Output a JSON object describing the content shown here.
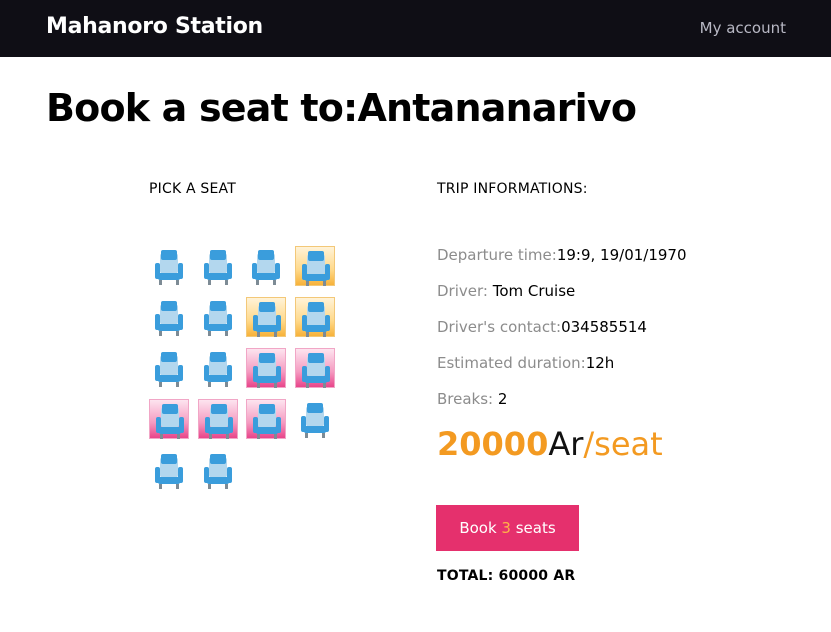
{
  "navbar": {
    "brand": "Mahanoro Station",
    "account_link": "My account"
  },
  "page": {
    "title": "Book a seat to:Antananarivo"
  },
  "pick": {
    "heading": "PICK A SEAT",
    "seats": [
      {
        "status": "available"
      },
      {
        "status": "available"
      },
      {
        "status": "available"
      },
      {
        "status": "selected"
      },
      {
        "status": "available"
      },
      {
        "status": "available"
      },
      {
        "status": "selected"
      },
      {
        "status": "selected"
      },
      {
        "status": "available"
      },
      {
        "status": "available"
      },
      {
        "status": "booked"
      },
      {
        "status": "booked"
      },
      {
        "status": "booked"
      },
      {
        "status": "booked"
      },
      {
        "status": "booked"
      },
      {
        "status": "available"
      },
      {
        "status": "available"
      },
      {
        "status": "available"
      }
    ]
  },
  "trip": {
    "heading": "TRIP INFORMATIONS:",
    "departure_label": "Departure time:",
    "departure_value": "19:9, 19/01/1970",
    "driver_label": "Driver: ",
    "driver_value": "Tom Cruise",
    "contact_label": "Driver's contact:",
    "contact_value": "034585514",
    "duration_label": "Estimated duration:",
    "duration_value": "12h",
    "breaks_label": "Breaks: ",
    "breaks_value": "2",
    "price_amount": "20000",
    "price_currency": "Ar",
    "price_unit": "/seat",
    "book_prefix": "Book ",
    "book_count": "3",
    "book_suffix": " seats",
    "total": "TOTAL: 60000 AR"
  },
  "colors": {
    "navbar_bg": "#0f0e15",
    "accent_orange": "#f39a21",
    "button_pink": "#e5306d",
    "seat_blue": "#3a9ddc"
  },
  "icons": {
    "seat": "seat-icon"
  }
}
